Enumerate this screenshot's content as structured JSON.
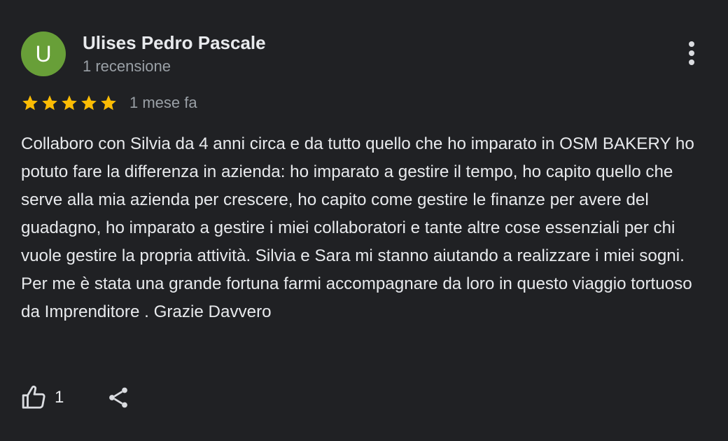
{
  "review": {
    "author": {
      "initial": "U",
      "name": "Ulises Pedro Pascale",
      "meta": "1 recensione",
      "avatar_color": "#689f38"
    },
    "rating": 5,
    "max_rating": 5,
    "star_color": "#fbbc04",
    "date": "1 mese fa",
    "text": "Collaboro con Silvia da 4 anni circa e da tutto quello che ho imparato in OSM BAKERY ho potuto fare la differenza in azienda: ho imparato a gestire il tempo, ho capito quello che serve alla mia azienda per crescere, ho capito come gestire le finanze per avere del guadagno, ho imparato a gestire i miei collaboratori e tante altre cose essenziali per chi vuole gestire la propria attività. Silvia e Sara mi stanno aiutando a realizzare i miei sogni. Per me è stata una grande fortuna farmi accompagnare da loro in questo viaggio tortuoso da Imprenditore . Grazie Davvero",
    "likes": "1",
    "icons": {
      "more": "more-vert-icon",
      "like": "thumb-up-icon",
      "share": "share-icon",
      "star": "star-icon"
    }
  }
}
